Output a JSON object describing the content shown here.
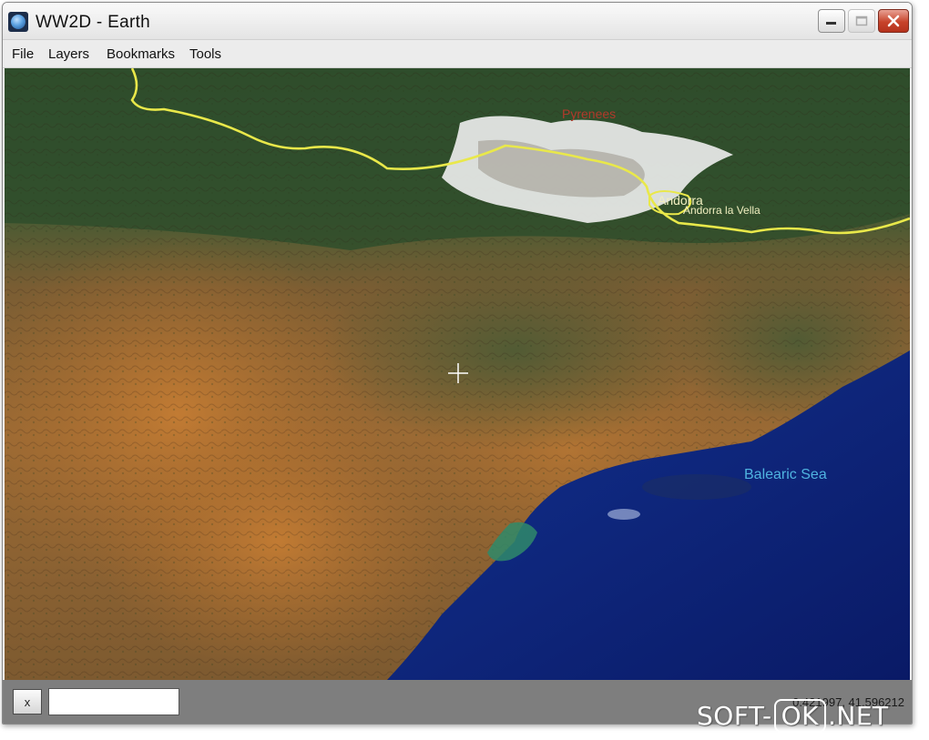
{
  "window": {
    "title": "WW2D - Earth",
    "controls": {
      "minimize": "minimize",
      "maximize": "maximize",
      "close": "close"
    }
  },
  "menubar": {
    "items": [
      {
        "label": "File"
      },
      {
        "label": "Layers"
      },
      {
        "label": "Bookmarks"
      },
      {
        "label": "Tools"
      }
    ]
  },
  "map": {
    "labels": {
      "pyrenees": "Pyrenees",
      "andorra": "Andorra",
      "andorra_la_vella": "Andorra la Vella",
      "sea": "Balearic Sea"
    },
    "colors": {
      "border_line": "#e9e84a",
      "sea": "#0d1f7a",
      "land_arid": "#a8692c",
      "land_green": "#2f4a2a",
      "sea_label": "#4fb3e0",
      "mountain_label": "#b0392b"
    }
  },
  "statusbar": {
    "close_label": "x",
    "search_value": "",
    "coordinates": "0.421997, 41.596212"
  },
  "watermark": {
    "left": "SOFT-",
    "middle": "OK",
    "right": ".NET"
  }
}
